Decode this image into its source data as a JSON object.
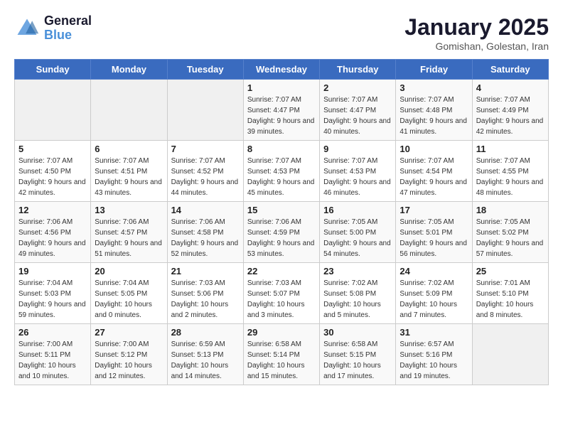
{
  "logo": {
    "line1": "General",
    "line2": "Blue"
  },
  "title": "January 2025",
  "subtitle": "Gomishan, Golestan, Iran",
  "days_of_week": [
    "Sunday",
    "Monday",
    "Tuesday",
    "Wednesday",
    "Thursday",
    "Friday",
    "Saturday"
  ],
  "weeks": [
    [
      {
        "day": "",
        "sunrise": "",
        "sunset": "",
        "daylight": "",
        "empty": true
      },
      {
        "day": "",
        "sunrise": "",
        "sunset": "",
        "daylight": "",
        "empty": true
      },
      {
        "day": "",
        "sunrise": "",
        "sunset": "",
        "daylight": "",
        "empty": true
      },
      {
        "day": "1",
        "sunrise": "Sunrise: 7:07 AM",
        "sunset": "Sunset: 4:47 PM",
        "daylight": "Daylight: 9 hours and 39 minutes."
      },
      {
        "day": "2",
        "sunrise": "Sunrise: 7:07 AM",
        "sunset": "Sunset: 4:47 PM",
        "daylight": "Daylight: 9 hours and 40 minutes."
      },
      {
        "day": "3",
        "sunrise": "Sunrise: 7:07 AM",
        "sunset": "Sunset: 4:48 PM",
        "daylight": "Daylight: 9 hours and 41 minutes."
      },
      {
        "day": "4",
        "sunrise": "Sunrise: 7:07 AM",
        "sunset": "Sunset: 4:49 PM",
        "daylight": "Daylight: 9 hours and 42 minutes."
      }
    ],
    [
      {
        "day": "5",
        "sunrise": "Sunrise: 7:07 AM",
        "sunset": "Sunset: 4:50 PM",
        "daylight": "Daylight: 9 hours and 42 minutes."
      },
      {
        "day": "6",
        "sunrise": "Sunrise: 7:07 AM",
        "sunset": "Sunset: 4:51 PM",
        "daylight": "Daylight: 9 hours and 43 minutes."
      },
      {
        "day": "7",
        "sunrise": "Sunrise: 7:07 AM",
        "sunset": "Sunset: 4:52 PM",
        "daylight": "Daylight: 9 hours and 44 minutes."
      },
      {
        "day": "8",
        "sunrise": "Sunrise: 7:07 AM",
        "sunset": "Sunset: 4:53 PM",
        "daylight": "Daylight: 9 hours and 45 minutes."
      },
      {
        "day": "9",
        "sunrise": "Sunrise: 7:07 AM",
        "sunset": "Sunset: 4:53 PM",
        "daylight": "Daylight: 9 hours and 46 minutes."
      },
      {
        "day": "10",
        "sunrise": "Sunrise: 7:07 AM",
        "sunset": "Sunset: 4:54 PM",
        "daylight": "Daylight: 9 hours and 47 minutes."
      },
      {
        "day": "11",
        "sunrise": "Sunrise: 7:07 AM",
        "sunset": "Sunset: 4:55 PM",
        "daylight": "Daylight: 9 hours and 48 minutes."
      }
    ],
    [
      {
        "day": "12",
        "sunrise": "Sunrise: 7:06 AM",
        "sunset": "Sunset: 4:56 PM",
        "daylight": "Daylight: 9 hours and 49 minutes."
      },
      {
        "day": "13",
        "sunrise": "Sunrise: 7:06 AM",
        "sunset": "Sunset: 4:57 PM",
        "daylight": "Daylight: 9 hours and 51 minutes."
      },
      {
        "day": "14",
        "sunrise": "Sunrise: 7:06 AM",
        "sunset": "Sunset: 4:58 PM",
        "daylight": "Daylight: 9 hours and 52 minutes."
      },
      {
        "day": "15",
        "sunrise": "Sunrise: 7:06 AM",
        "sunset": "Sunset: 4:59 PM",
        "daylight": "Daylight: 9 hours and 53 minutes."
      },
      {
        "day": "16",
        "sunrise": "Sunrise: 7:05 AM",
        "sunset": "Sunset: 5:00 PM",
        "daylight": "Daylight: 9 hours and 54 minutes."
      },
      {
        "day": "17",
        "sunrise": "Sunrise: 7:05 AM",
        "sunset": "Sunset: 5:01 PM",
        "daylight": "Daylight: 9 hours and 56 minutes."
      },
      {
        "day": "18",
        "sunrise": "Sunrise: 7:05 AM",
        "sunset": "Sunset: 5:02 PM",
        "daylight": "Daylight: 9 hours and 57 minutes."
      }
    ],
    [
      {
        "day": "19",
        "sunrise": "Sunrise: 7:04 AM",
        "sunset": "Sunset: 5:03 PM",
        "daylight": "Daylight: 9 hours and 59 minutes."
      },
      {
        "day": "20",
        "sunrise": "Sunrise: 7:04 AM",
        "sunset": "Sunset: 5:05 PM",
        "daylight": "Daylight: 10 hours and 0 minutes."
      },
      {
        "day": "21",
        "sunrise": "Sunrise: 7:03 AM",
        "sunset": "Sunset: 5:06 PM",
        "daylight": "Daylight: 10 hours and 2 minutes."
      },
      {
        "day": "22",
        "sunrise": "Sunrise: 7:03 AM",
        "sunset": "Sunset: 5:07 PM",
        "daylight": "Daylight: 10 hours and 3 minutes."
      },
      {
        "day": "23",
        "sunrise": "Sunrise: 7:02 AM",
        "sunset": "Sunset: 5:08 PM",
        "daylight": "Daylight: 10 hours and 5 minutes."
      },
      {
        "day": "24",
        "sunrise": "Sunrise: 7:02 AM",
        "sunset": "Sunset: 5:09 PM",
        "daylight": "Daylight: 10 hours and 7 minutes."
      },
      {
        "day": "25",
        "sunrise": "Sunrise: 7:01 AM",
        "sunset": "Sunset: 5:10 PM",
        "daylight": "Daylight: 10 hours and 8 minutes."
      }
    ],
    [
      {
        "day": "26",
        "sunrise": "Sunrise: 7:00 AM",
        "sunset": "Sunset: 5:11 PM",
        "daylight": "Daylight: 10 hours and 10 minutes."
      },
      {
        "day": "27",
        "sunrise": "Sunrise: 7:00 AM",
        "sunset": "Sunset: 5:12 PM",
        "daylight": "Daylight: 10 hours and 12 minutes."
      },
      {
        "day": "28",
        "sunrise": "Sunrise: 6:59 AM",
        "sunset": "Sunset: 5:13 PM",
        "daylight": "Daylight: 10 hours and 14 minutes."
      },
      {
        "day": "29",
        "sunrise": "Sunrise: 6:58 AM",
        "sunset": "Sunset: 5:14 PM",
        "daylight": "Daylight: 10 hours and 15 minutes."
      },
      {
        "day": "30",
        "sunrise": "Sunrise: 6:58 AM",
        "sunset": "Sunset: 5:15 PM",
        "daylight": "Daylight: 10 hours and 17 minutes."
      },
      {
        "day": "31",
        "sunrise": "Sunrise: 6:57 AM",
        "sunset": "Sunset: 5:16 PM",
        "daylight": "Daylight: 10 hours and 19 minutes."
      },
      {
        "day": "",
        "sunrise": "",
        "sunset": "",
        "daylight": "",
        "empty": true
      }
    ]
  ]
}
